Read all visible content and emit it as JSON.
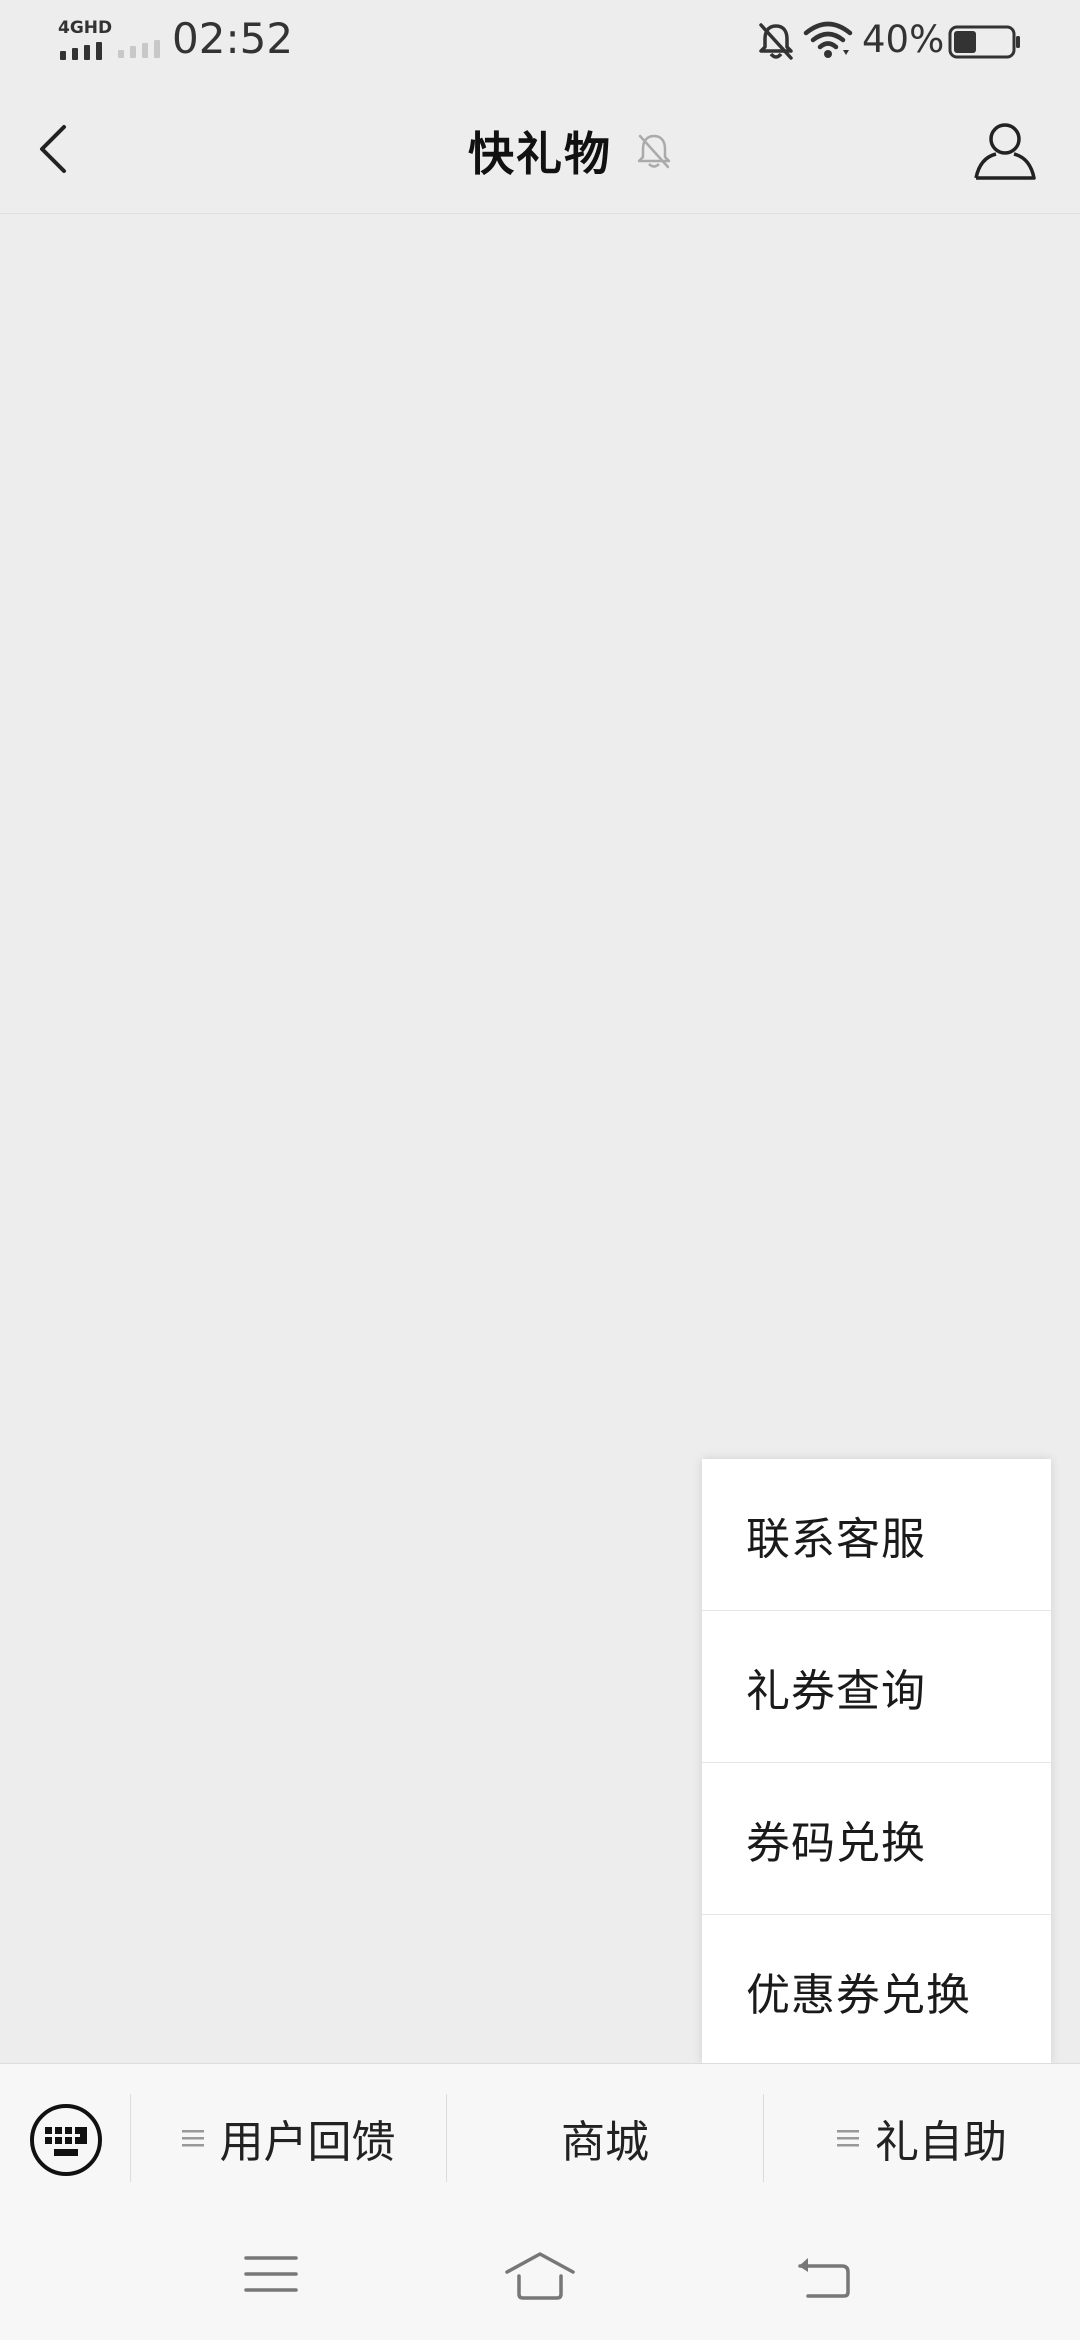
{
  "status_bar": {
    "network_label": "4GHD",
    "time": "02:52",
    "battery_percent": "40%",
    "battery_level": 0.4,
    "icons": [
      "bell-off-icon",
      "wifi-icon",
      "battery-icon"
    ]
  },
  "header": {
    "title": "快礼物",
    "icons": [
      "back-arrow-icon",
      "mute-bell-icon",
      "person-icon"
    ]
  },
  "popup_menu": {
    "items": [
      {
        "label": "联系客服"
      },
      {
        "label": "礼券查询"
      },
      {
        "label": "券码兑换"
      },
      {
        "label": "优惠券兑换"
      }
    ]
  },
  "menu_bar": {
    "tabs": [
      {
        "label": "用户回馈",
        "has_submenu": true
      },
      {
        "label": "商城",
        "has_submenu": false
      },
      {
        "label": "礼自助",
        "has_submenu": true
      }
    ],
    "icons": [
      "keyboard-icon",
      "list-icon"
    ]
  },
  "nav_bar": {
    "icons": [
      "menu-lines-icon",
      "home-icon",
      "back-return-icon"
    ]
  },
  "colors": {
    "background": "#ededed",
    "surface": "#ffffff",
    "bar": "#f7f7f7",
    "text": "#1a1a1a",
    "muted": "#9e9e9e"
  }
}
